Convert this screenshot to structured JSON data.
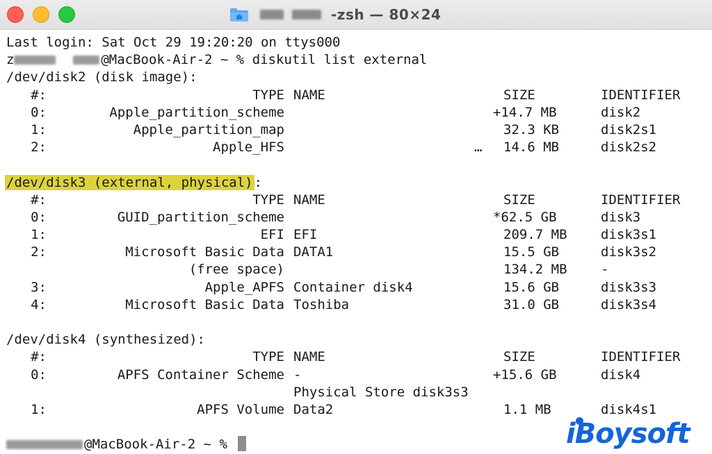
{
  "window": {
    "title": "-zsh — 80×24",
    "icon": "home-folder-icon"
  },
  "terminal": {
    "last_login": "Last login: Sat Oct 29 19:20:20 on ttys000",
    "prompt1_suffix": "@MacBook-Air-2 ~ % ",
    "command": "diskutil list external",
    "headers": {
      "num": "#:",
      "type": "TYPE",
      "name": "NAME",
      "size": "SIZE",
      "identifier": "IDENTIFIER"
    },
    "disks": [
      {
        "header": "/dev/disk2 (disk image):",
        "rows": [
          {
            "num": "0:",
            "type": "Apple_partition_scheme",
            "name": "",
            "size": "+14.7 MB",
            "id": "disk2"
          },
          {
            "num": "1:",
            "type": "Apple_partition_map",
            "name": "",
            "size": "32.3 KB",
            "id": "disk2s1"
          },
          {
            "num": "2:",
            "type": "Apple_HFS",
            "name": "…",
            "size": "14.6 MB",
            "id": "disk2s2"
          }
        ]
      },
      {
        "header_highlighted": "/dev/disk3 (external, physical)",
        "header_rest": ":",
        "rows": [
          {
            "num": "0:",
            "type": "GUID_partition_scheme",
            "name": "",
            "size": "*62.5 GB",
            "id": "disk3"
          },
          {
            "num": "1:",
            "type": "EFI",
            "name": "EFI",
            "size": "209.7 MB",
            "id": "disk3s1"
          },
          {
            "num": "2:",
            "type": "Microsoft Basic Data",
            "name": "DATA1",
            "size": "15.5 GB",
            "id": "disk3s2"
          },
          {
            "num": "",
            "type": "(free space)",
            "name": "",
            "size": "134.2 MB",
            "id": "-"
          },
          {
            "num": "3:",
            "type": "Apple_APFS",
            "name": "Container disk4",
            "size": "15.6 GB",
            "id": "disk3s3"
          },
          {
            "num": "4:",
            "type": "Microsoft Basic Data",
            "name": "Toshiba",
            "size": "31.0 GB",
            "id": "disk3s4"
          }
        ]
      },
      {
        "header": "/dev/disk4 (synthesized):",
        "rows": [
          {
            "num": "0:",
            "type": "APFS Container Scheme",
            "name": "-",
            "size": "+15.6 GB",
            "id": "disk4"
          },
          {
            "num": "",
            "type": "",
            "name": "Physical Store disk3s3",
            "size": "",
            "id": ""
          },
          {
            "num": "1:",
            "type": "APFS Volume",
            "name": "Data2",
            "size": "1.1 MB",
            "id": "disk4s1"
          }
        ]
      }
    ],
    "prompt2_suffix": "@MacBook-Air-2 ~ % "
  },
  "watermark": {
    "text": "iBoysoft",
    "color": "#1565d8"
  },
  "colors": {
    "highlight": "#dcd33c",
    "close": "#fe5f57",
    "minimize": "#febc2e",
    "maximize": "#28c840"
  }
}
